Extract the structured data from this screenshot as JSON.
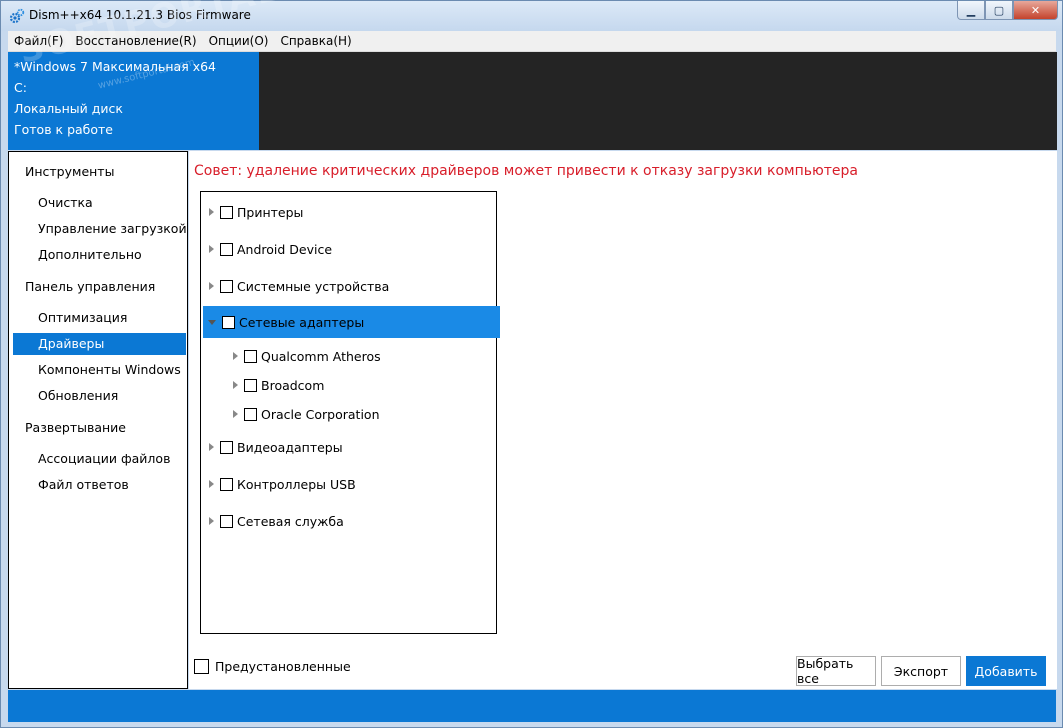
{
  "window": {
    "title": "Dism++x64 10.1.21.3 Bios Firmware"
  },
  "menu": [
    {
      "label": "Файл(F)"
    },
    {
      "label": "Восстановление(R)"
    },
    {
      "label": "Опции(O)"
    },
    {
      "label": "Справка(H)"
    }
  ],
  "info": {
    "os": "*Windows 7 Максимальная x64",
    "drive": "C:",
    "disk": "Локальный диск",
    "status": "Готов к работе"
  },
  "watermark": {
    "text": "SOFTPORTAL",
    "sub": "www.softportal.com"
  },
  "sidebar": {
    "tools": "Инструменты",
    "cleanup": "Очистка",
    "boot": "Управление загрузкой",
    "advanced": "Дополнительно",
    "control": "Панель управления",
    "optimize": "Оптимизация",
    "drivers": "Драйверы",
    "components": "Компоненты Windows",
    "updates": "Обновления",
    "deploy": "Развертывание",
    "assoc": "Ассоциации файлов",
    "answer": "Файл ответов"
  },
  "content": {
    "tip": "Совет: удаление критических драйверов может привести к отказу загрузки компьютера",
    "tree": {
      "printers": "Принтеры",
      "android": "Android Device",
      "system": "Системные устройства",
      "network": "Сетевые адаптеры",
      "qualcomm": "Qualcomm Atheros",
      "broadcom": "Broadcom",
      "oracle": "Oracle Corporation",
      "video": "Видеоадаптеры",
      "usb": "Контроллеры USB",
      "netservice": "Сетевая служба"
    },
    "preinstalled": "Предустановленные",
    "select_all": "Выбрать все",
    "export": "Экспорт",
    "add": "Добавить"
  },
  "colors": {
    "accent": "#0b78d4",
    "tip": "#d81e2a",
    "selected_row": "#1a8ae6"
  }
}
